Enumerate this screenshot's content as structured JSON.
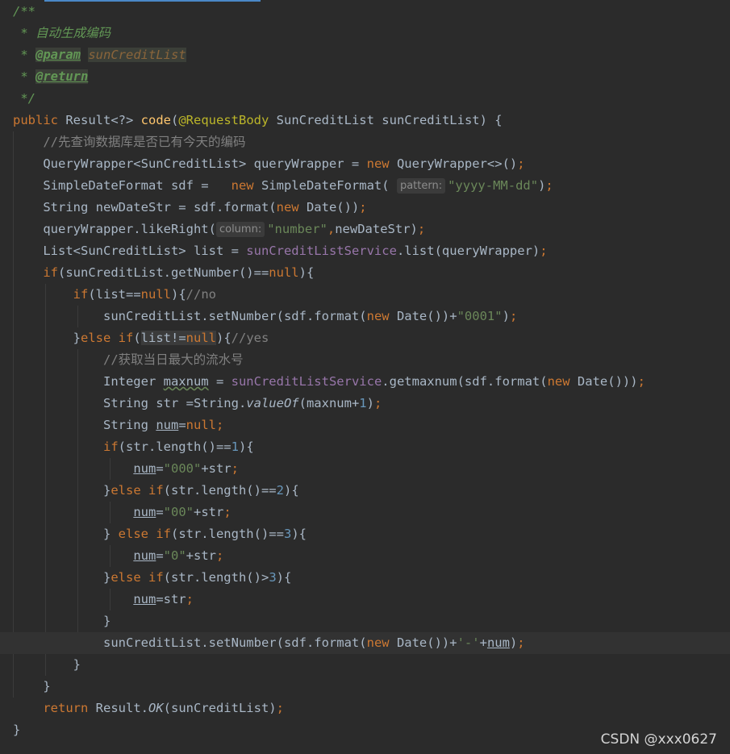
{
  "editor": {
    "background": "#2b2b2b",
    "current_line_background": "#323232",
    "colors": {
      "keyword": "#cc7832",
      "doc_comment": "#629755",
      "annotation": "#bbb529",
      "method_declaration": "#ffc66d",
      "string": "#6a8759",
      "number": "#6897bb",
      "line_comment": "#808080",
      "field": "#9876aa",
      "default_text": "#a9b7c6"
    },
    "lines": [
      [
        {
          "t": "/**",
          "c": "doc"
        }
      ],
      [
        {
          "t": " * 自动生成编码",
          "c": "doc"
        }
      ],
      [
        {
          "t": " * ",
          "c": "doc"
        },
        {
          "t": "@param",
          "c": "tag"
        },
        {
          "t": " ",
          "c": "doc"
        },
        {
          "t": "sunCreditList",
          "c": "docparam"
        }
      ],
      [
        {
          "t": " * ",
          "c": "doc"
        },
        {
          "t": "@return",
          "c": "tag"
        }
      ],
      [
        {
          "t": " */",
          "c": "doc"
        }
      ],
      [
        {
          "t": "public ",
          "c": "kw"
        },
        {
          "t": "Result<?> ",
          "c": ""
        },
        {
          "t": "code",
          "c": "fn"
        },
        {
          "t": "(",
          "c": ""
        },
        {
          "t": "@RequestBody ",
          "c": "ann"
        },
        {
          "t": "SunCreditList sunCreditList) {",
          "c": ""
        }
      ],
      [
        {
          "t": "    ",
          "c": ""
        },
        {
          "t": "//先查询数据库是否已有今天的编码",
          "c": "cmt"
        }
      ],
      [
        {
          "t": "    QueryWrapper<SunCreditList> queryWrapper = ",
          "c": ""
        },
        {
          "t": "new ",
          "c": "kw"
        },
        {
          "t": "QueryWrapper<>()",
          "c": ""
        },
        {
          "t": ";",
          "c": "kw"
        }
      ],
      [
        {
          "t": "    SimpleDateFormat sdf =   ",
          "c": ""
        },
        {
          "t": "new ",
          "c": "kw"
        },
        {
          "t": "SimpleDateFormat( ",
          "c": ""
        },
        {
          "t": "pattern:",
          "c": "hint"
        },
        {
          "t": "\"yyyy-MM-dd\"",
          "c": "str"
        },
        {
          "t": ")",
          "c": ""
        },
        {
          "t": ";",
          "c": "kw"
        }
      ],
      [
        {
          "t": "    String newDateStr = sdf.format(",
          "c": ""
        },
        {
          "t": "new ",
          "c": "kw"
        },
        {
          "t": "Date())",
          "c": ""
        },
        {
          "t": ";",
          "c": "kw"
        }
      ],
      [
        {
          "t": "    queryWrapper.likeRight(",
          "c": ""
        },
        {
          "t": "column:",
          "c": "hint"
        },
        {
          "t": "\"number\"",
          "c": "str"
        },
        {
          "t": ",",
          "c": "kw"
        },
        {
          "t": "newDateStr)",
          "c": ""
        },
        {
          "t": ";",
          "c": "kw"
        }
      ],
      [
        {
          "t": "    List<SunCreditList> list = ",
          "c": ""
        },
        {
          "t": "sunCreditListService",
          "c": "field"
        },
        {
          "t": ".list(queryWrapper)",
          "c": ""
        },
        {
          "t": ";",
          "c": "kw"
        }
      ],
      [
        {
          "t": "    ",
          "c": ""
        },
        {
          "t": "if",
          "c": "kw"
        },
        {
          "t": "(sunCreditList.getNumber()==",
          "c": ""
        },
        {
          "t": "null",
          "c": "kw"
        },
        {
          "t": "){",
          "c": ""
        }
      ],
      [
        {
          "t": "        ",
          "c": ""
        },
        {
          "t": "if",
          "c": "kw"
        },
        {
          "t": "(list==",
          "c": ""
        },
        {
          "t": "null",
          "c": "kw"
        },
        {
          "t": "){",
          "c": ""
        },
        {
          "t": "//no",
          "c": "cmt"
        }
      ],
      [
        {
          "t": "            sunCreditList.setNumber(sdf.format(",
          "c": ""
        },
        {
          "t": "new ",
          "c": "kw"
        },
        {
          "t": "Date())+",
          "c": ""
        },
        {
          "t": "\"0001\"",
          "c": "str"
        },
        {
          "t": ")",
          "c": ""
        },
        {
          "t": ";",
          "c": "kw"
        }
      ],
      [
        {
          "t": "        }",
          "c": ""
        },
        {
          "t": "else if",
          "c": "kw"
        },
        {
          "t": "(",
          "c": ""
        },
        {
          "t": "list!=",
          "c": "hl"
        },
        {
          "t": "null",
          "c": "kwhl"
        },
        {
          "t": "){",
          "c": ""
        },
        {
          "t": "//yes",
          "c": "cmt"
        }
      ],
      [
        {
          "t": "            ",
          "c": ""
        },
        {
          "t": "//获取当日最大的流水号",
          "c": "cmt"
        }
      ],
      [
        {
          "t": "            Integer ",
          "c": ""
        },
        {
          "t": "maxnum",
          "c": "wavy"
        },
        {
          "t": " = ",
          "c": ""
        },
        {
          "t": "sunCreditListService",
          "c": "field"
        },
        {
          "t": ".getmaxnum(sdf.format(",
          "c": ""
        },
        {
          "t": "new ",
          "c": "kw"
        },
        {
          "t": "Date()))",
          "c": ""
        },
        {
          "t": ";",
          "c": "kw"
        }
      ],
      [
        {
          "t": "            String str =String.",
          "c": ""
        },
        {
          "t": "valueOf",
          "c": "italic"
        },
        {
          "t": "(maxnum+",
          "c": ""
        },
        {
          "t": "1",
          "c": "num"
        },
        {
          "t": ")",
          "c": ""
        },
        {
          "t": ";",
          "c": "kw"
        }
      ],
      [
        {
          "t": "            String ",
          "c": ""
        },
        {
          "t": "num",
          "c": "under"
        },
        {
          "t": "=",
          "c": ""
        },
        {
          "t": "null;",
          "c": "kw"
        }
      ],
      [
        {
          "t": "            ",
          "c": ""
        },
        {
          "t": "if",
          "c": "kw"
        },
        {
          "t": "(str.length()==",
          "c": ""
        },
        {
          "t": "1",
          "c": "num"
        },
        {
          "t": "){",
          "c": ""
        }
      ],
      [
        {
          "t": "                ",
          "c": ""
        },
        {
          "t": "num",
          "c": "under"
        },
        {
          "t": "=",
          "c": ""
        },
        {
          "t": "\"000\"",
          "c": "str"
        },
        {
          "t": "+str",
          "c": ""
        },
        {
          "t": ";",
          "c": "kw"
        }
      ],
      [
        {
          "t": "            }",
          "c": ""
        },
        {
          "t": "else if",
          "c": "kw"
        },
        {
          "t": "(str.length()==",
          "c": ""
        },
        {
          "t": "2",
          "c": "num"
        },
        {
          "t": "){",
          "c": ""
        }
      ],
      [
        {
          "t": "                ",
          "c": ""
        },
        {
          "t": "num",
          "c": "under"
        },
        {
          "t": "=",
          "c": ""
        },
        {
          "t": "\"00\"",
          "c": "str"
        },
        {
          "t": "+str",
          "c": ""
        },
        {
          "t": ";",
          "c": "kw"
        }
      ],
      [
        {
          "t": "            } ",
          "c": ""
        },
        {
          "t": "else if",
          "c": "kw"
        },
        {
          "t": "(str.length()==",
          "c": ""
        },
        {
          "t": "3",
          "c": "num"
        },
        {
          "t": "){",
          "c": ""
        }
      ],
      [
        {
          "t": "                ",
          "c": ""
        },
        {
          "t": "num",
          "c": "under"
        },
        {
          "t": "=",
          "c": ""
        },
        {
          "t": "\"0\"",
          "c": "str"
        },
        {
          "t": "+str",
          "c": ""
        },
        {
          "t": ";",
          "c": "kw"
        }
      ],
      [
        {
          "t": "            }",
          "c": ""
        },
        {
          "t": "else if",
          "c": "kw"
        },
        {
          "t": "(str.length()>",
          "c": ""
        },
        {
          "t": "3",
          "c": "num"
        },
        {
          "t": "){",
          "c": ""
        }
      ],
      [
        {
          "t": "                ",
          "c": ""
        },
        {
          "t": "num",
          "c": "under"
        },
        {
          "t": "=str",
          "c": ""
        },
        {
          "t": ";",
          "c": "kw"
        }
      ],
      [
        {
          "t": "            }",
          "c": ""
        }
      ],
      [
        {
          "t": "            sunCreditList.setNumber(sdf.format(",
          "c": ""
        },
        {
          "t": "new ",
          "c": "kw"
        },
        {
          "t": "Date())+",
          "c": ""
        },
        {
          "t": "'-'",
          "c": "str"
        },
        {
          "t": "+",
          "c": ""
        },
        {
          "t": "num",
          "c": "under"
        },
        {
          "t": ")",
          "c": ""
        },
        {
          "t": ";",
          "c": "kw"
        }
      ],
      [
        {
          "t": "        }",
          "c": ""
        }
      ],
      [
        {
          "t": "    }",
          "c": ""
        }
      ],
      [
        {
          "t": "    ",
          "c": ""
        },
        {
          "t": "return ",
          "c": "kw"
        },
        {
          "t": "Result.",
          "c": ""
        },
        {
          "t": "OK",
          "c": "italic"
        },
        {
          "t": "(sunCreditList)",
          "c": ""
        },
        {
          "t": ";",
          "c": "kw"
        }
      ],
      [
        {
          "t": "}",
          "c": ""
        }
      ]
    ]
  },
  "watermark": {
    "text": "CSDN @xxx0627"
  }
}
